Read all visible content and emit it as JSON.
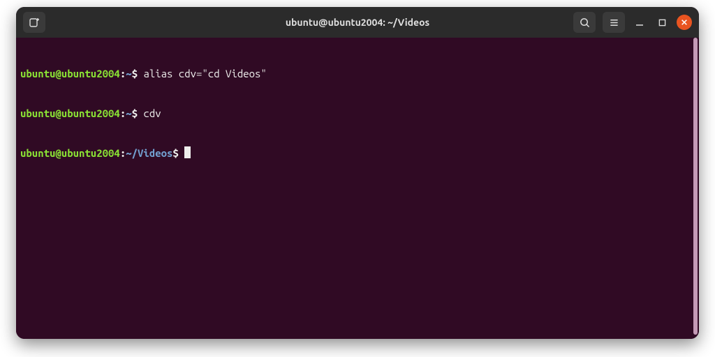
{
  "window": {
    "title": "ubuntu@ubuntu2004: ~/Videos"
  },
  "titlebar": {
    "new_tab_icon": "new-tab-icon",
    "search_icon": "search-icon",
    "menu_icon": "hamburger-icon",
    "minimize_icon": "minimize-icon",
    "maximize_icon": "maximize-icon",
    "close_icon": "close-icon"
  },
  "terminal": {
    "lines": [
      {
        "user": "ubuntu@ubuntu2004",
        "path": "~",
        "command": "alias cdv=\"cd Videos\""
      },
      {
        "user": "ubuntu@ubuntu2004",
        "path": "~",
        "command": "cdv"
      },
      {
        "user": "ubuntu@ubuntu2004",
        "path": "~/Videos",
        "command": ""
      }
    ]
  },
  "colors": {
    "background": "#300a24",
    "titlebar": "#2b2b2b",
    "close_btn": "#e95420",
    "prompt_user": "#8ae234",
    "prompt_path": "#729fcf",
    "text": "#eeeeec"
  }
}
